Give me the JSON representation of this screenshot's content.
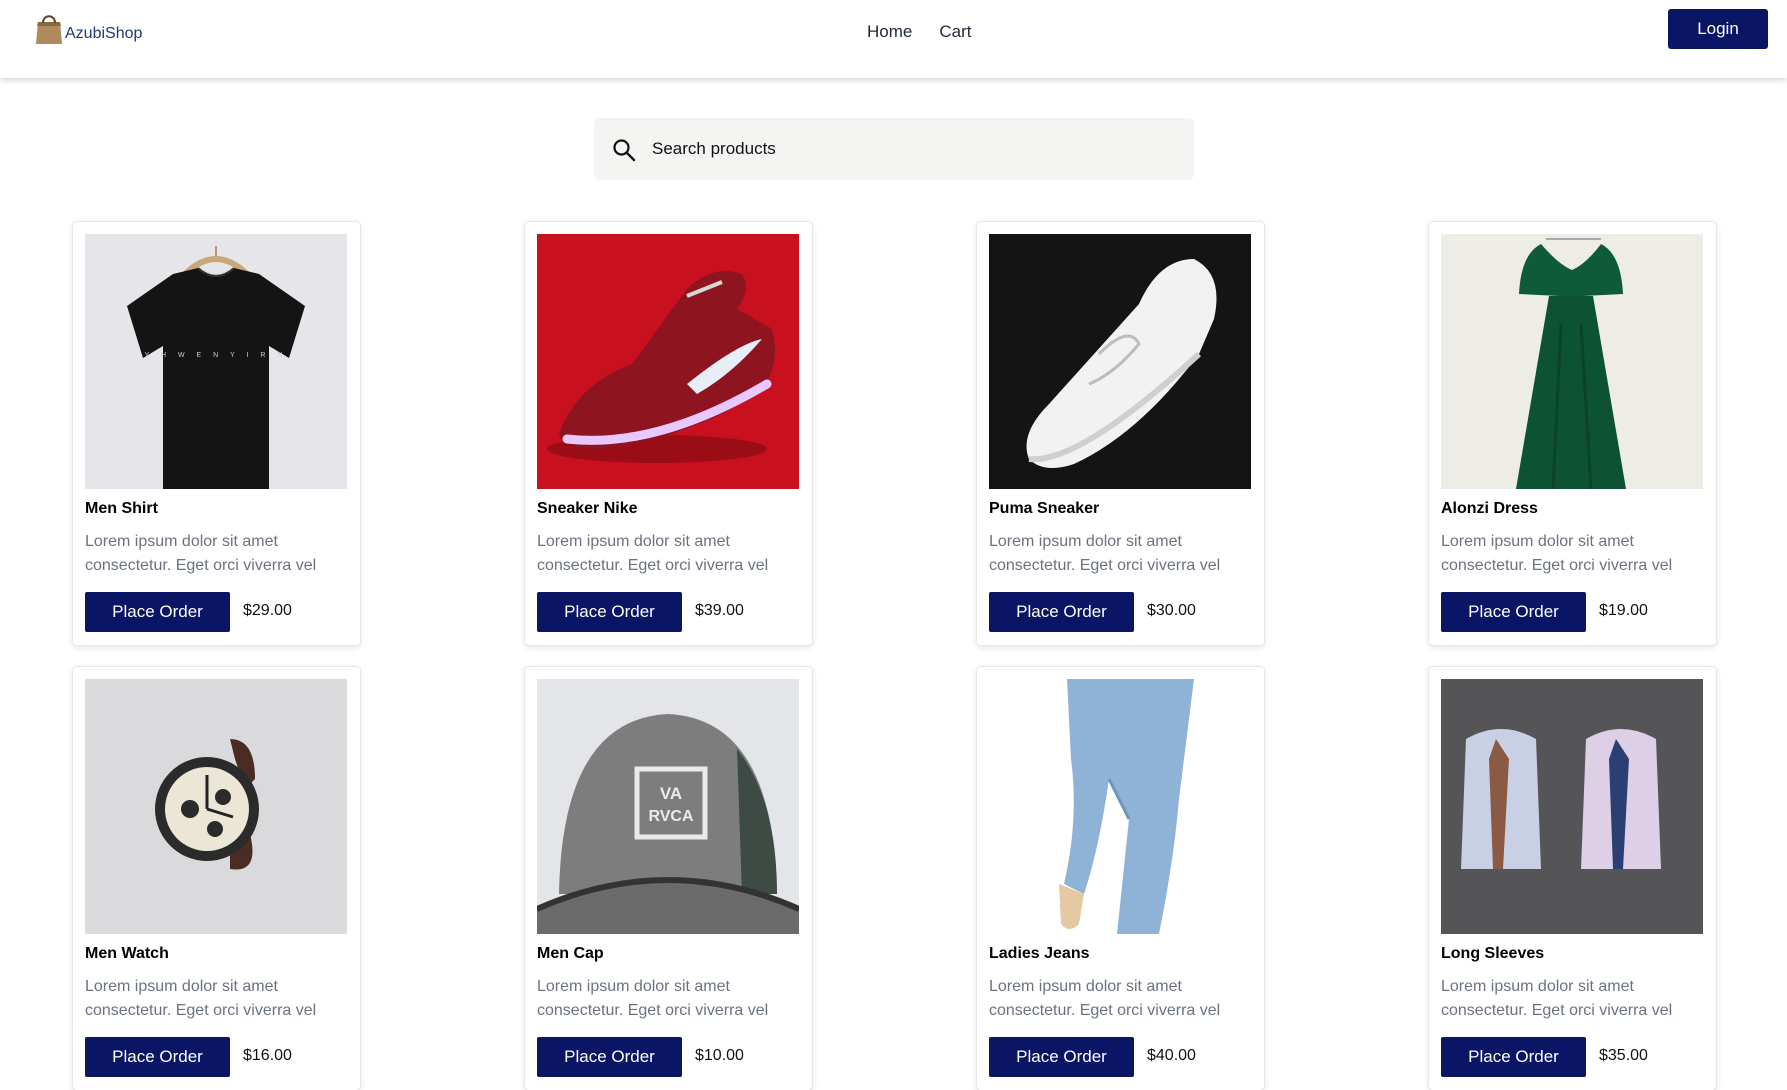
{
  "brand": {
    "name": "AzubiShop",
    "logo_icon": "shopping-bag-icon"
  },
  "nav": {
    "home": "Home",
    "cart": "Cart"
  },
  "header": {
    "login_label": "Login"
  },
  "search": {
    "placeholder": "Search products",
    "value": "",
    "icon": "search-icon"
  },
  "colors": {
    "primary": "#0a1566",
    "search_bg": "#f4f4f3",
    "text_muted": "#6b7280"
  },
  "order_label": "Place Order",
  "products": [
    {
      "name": "Men Shirt",
      "description": "Lorem ipsum dolor sit amet consectetur. Eget orci viverra vel",
      "price": "$29.00",
      "image": "black-tshirt-image"
    },
    {
      "name": "Sneaker Nike",
      "description": "Lorem ipsum dolor sit amet consectetur. Eget orci viverra vel",
      "price": "$39.00",
      "image": "red-nike-sneaker-image"
    },
    {
      "name": "Puma Sneaker",
      "description": "Lorem ipsum dolor sit amet consectetur. Eget orci viverra vel",
      "price": "$30.00",
      "image": "white-puma-sneaker-image"
    },
    {
      "name": "Alonzi Dress",
      "description": "Lorem ipsum dolor sit amet consectetur. Eget orci viverra vel",
      "price": "$19.00",
      "image": "green-dress-image"
    },
    {
      "name": "Men Watch",
      "description": "Lorem ipsum dolor sit amet consectetur. Eget orci viverra vel",
      "price": "$16.00",
      "image": "wrist-watch-image"
    },
    {
      "name": "Men Cap",
      "description": "Lorem ipsum dolor sit amet consectetur. Eget orci viverra vel",
      "price": "$10.00",
      "image": "grey-cap-image",
      "image_text": [
        "VA",
        "RVCA"
      ]
    },
    {
      "name": "Ladies Jeans",
      "description": "Lorem ipsum dolor sit amet consectetur. Eget orci viverra vel",
      "price": "$40.00",
      "image": "blue-jeans-image"
    },
    {
      "name": "Long Sleeves",
      "description": "Lorem ipsum dolor sit amet consectetur. Eget orci viverra vel",
      "price": "$35.00",
      "image": "dress-shirts-image"
    }
  ]
}
